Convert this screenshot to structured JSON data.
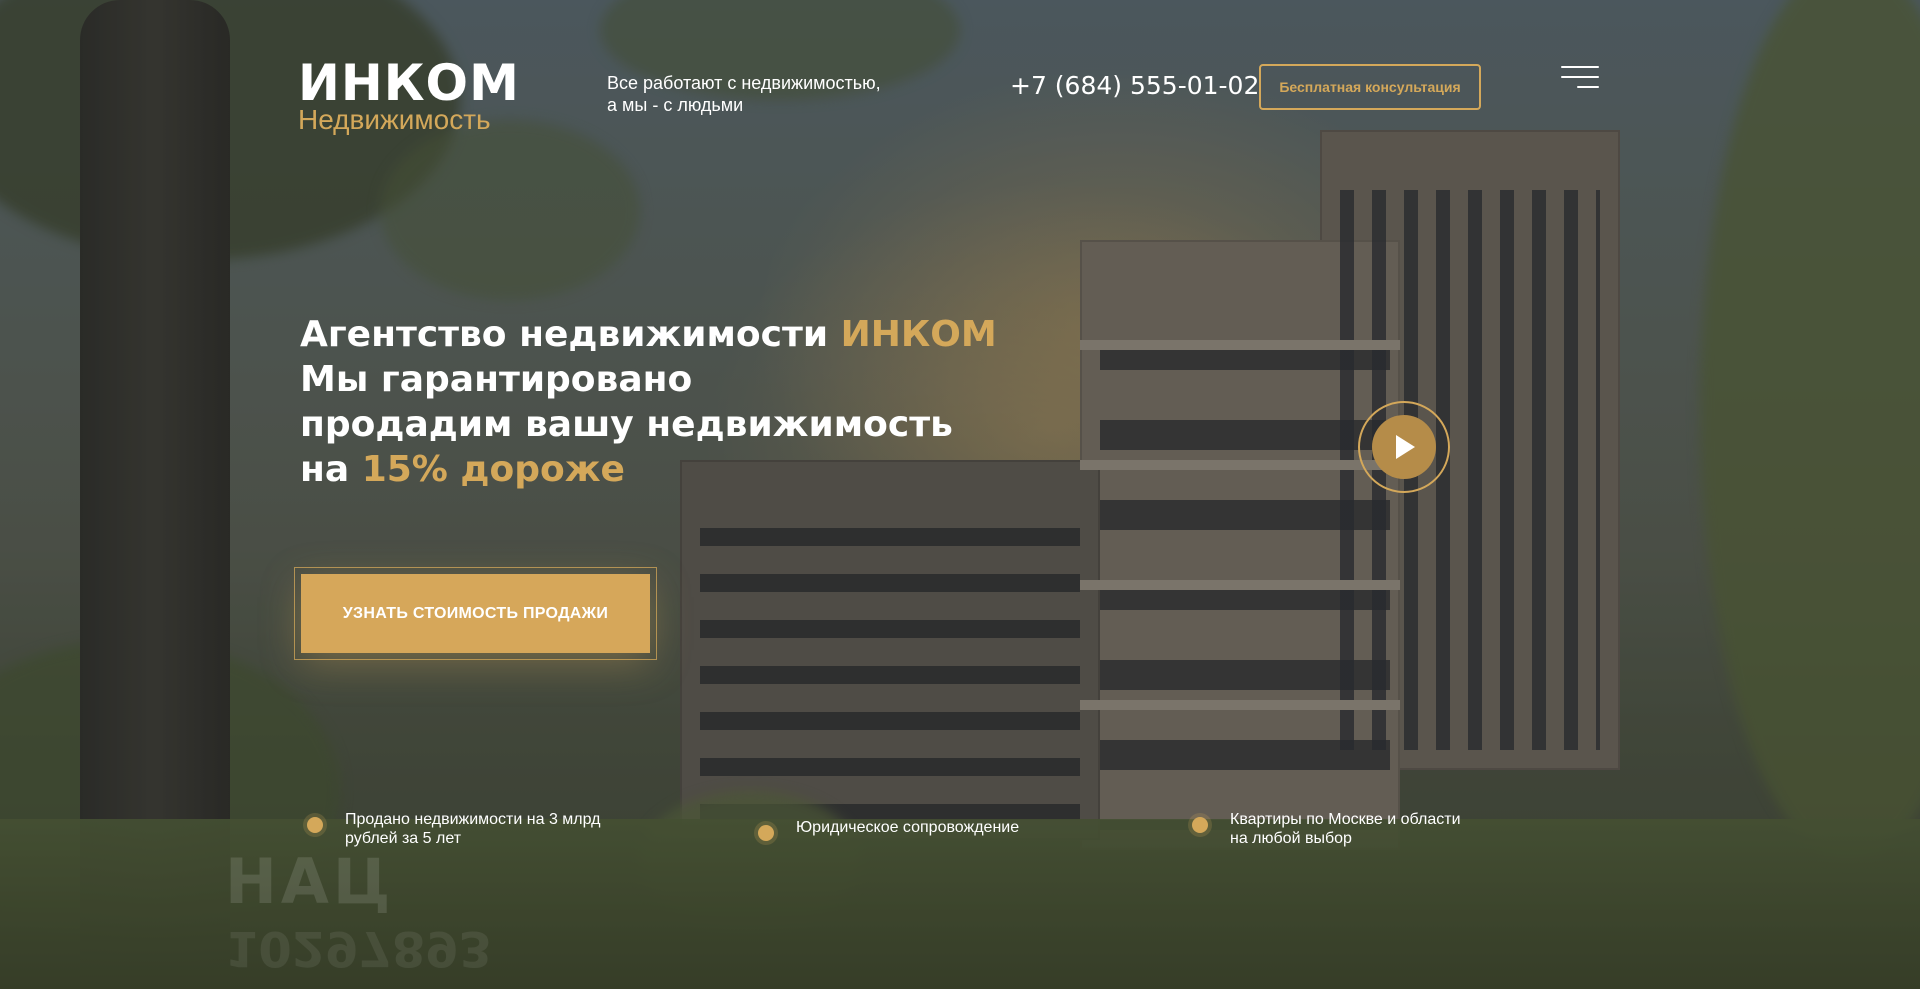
{
  "colors": {
    "accent": "#d4a85a",
    "button": "#d6a75a",
    "text": "#ffffff"
  },
  "brand": {
    "name": "ИНКОМ",
    "subtitle": "Недвижимость"
  },
  "header": {
    "tagline_line1": "Все работают с недвижимостью,",
    "tagline_line2": "а мы - с людьми",
    "phone": "+7 (684) 555-01-02",
    "consult_button": "Бесплатная консультация",
    "menu_icon": "hamburger-menu-icon"
  },
  "hero": {
    "line1_prefix": "Агентство недвижимости ",
    "line1_highlight": "ИНКОМ",
    "line2": "Мы гарантировано",
    "line3": "продадим  вашу недвижимость",
    "line4_prefix": "на ",
    "line4_highlight": "15% дороже",
    "cta_button": "УЗНАТЬ СТОИМОСТЬ ПРОДАЖИ",
    "video_icon": "play-icon"
  },
  "features": [
    {
      "line1": "Продано недвижимости на 3 млрд",
      "line2": "рублей за 5 лет"
    },
    {
      "line1": "Юридическое  сопровождение",
      "line2": ""
    },
    {
      "line1": "Квартиры по Москве и области",
      "line2": "на любой выбор"
    }
  ],
  "watermark": {
    "text": "НАЦ",
    "number": "10297893"
  }
}
